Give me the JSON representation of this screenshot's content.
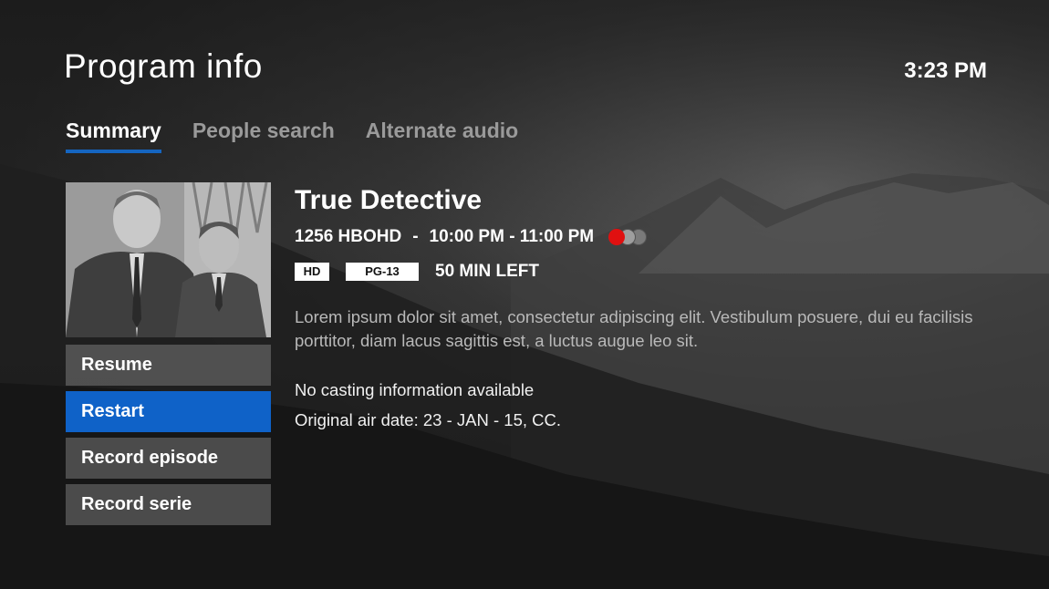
{
  "header": {
    "title": "Program info",
    "clock": "3:23 PM"
  },
  "tabs": [
    {
      "label": "Summary",
      "active": true
    },
    {
      "label": "People search",
      "active": false
    },
    {
      "label": "Alternate audio",
      "active": false
    }
  ],
  "actions": [
    {
      "label": "Resume",
      "selected": false
    },
    {
      "label": "Restart",
      "selected": true
    },
    {
      "label": "Record episode",
      "selected": false
    },
    {
      "label": "Record serie",
      "selected": false
    }
  ],
  "program": {
    "title": "True Detective",
    "channel": "1256 HBOHD",
    "separator": "-",
    "time_range": "10:00 PM - 11:00 PM",
    "quality_badge": "HD",
    "rating_badge": "PG-13",
    "time_left": "50 MIN LEFT",
    "description": "Lorem ipsum dolor sit amet, consectetur adipiscing elit. Vestibulum posuere, dui eu facilisis porttitor, diam lacus sagittis est, a luctus augue leo sit.",
    "casting": "No casting information available",
    "air_date": "Original air date: 23 - JAN - 15, CC."
  },
  "colors": {
    "accent": "#0f62c8",
    "record": "#e01010"
  }
}
